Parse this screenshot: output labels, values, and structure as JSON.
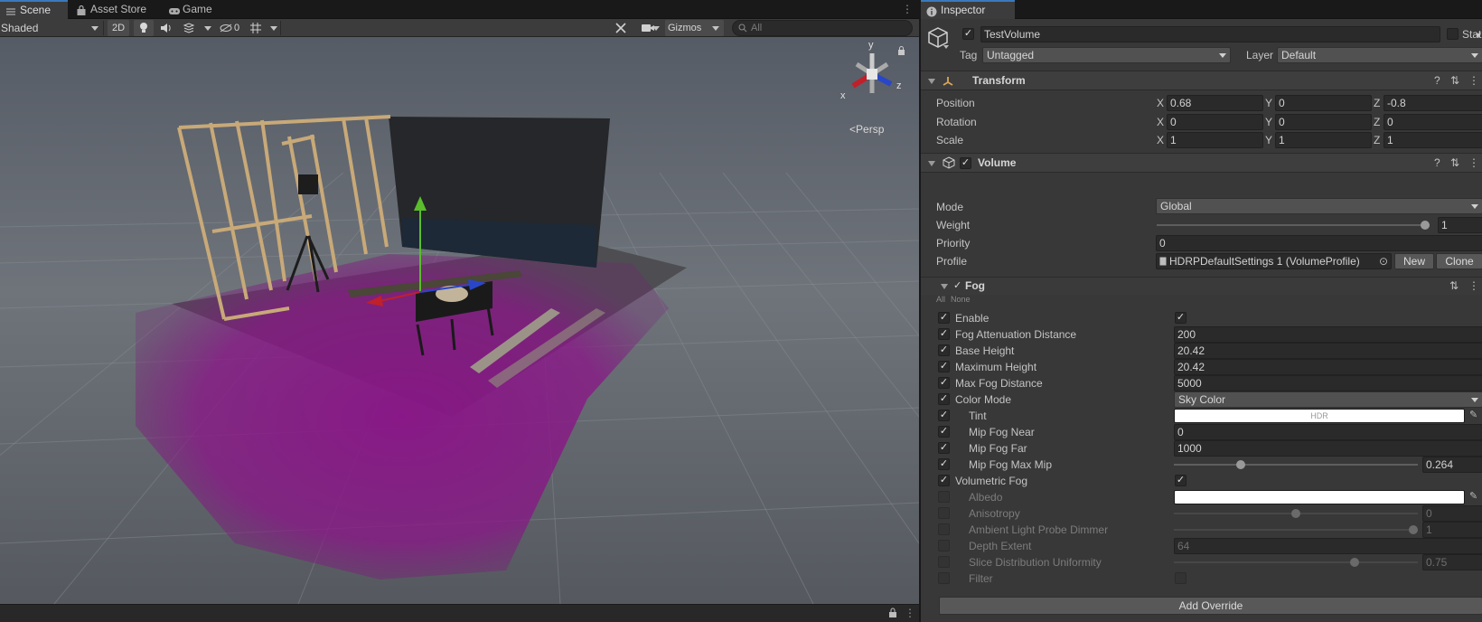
{
  "scene_tabs": [
    {
      "label": "Scene"
    },
    {
      "label": "Asset Store"
    },
    {
      "label": "Game"
    }
  ],
  "scene_toolbar": {
    "shading_mode": "Shaded",
    "mode_2d": "2D",
    "hidden_count": "0",
    "gizmos": "Gizmos",
    "search_placeholder": "All"
  },
  "orientation_gizmo": {
    "y": "y",
    "x": "x",
    "z": "z",
    "projection": "Persp"
  },
  "inspector": {
    "tab": "Inspector",
    "object_name": "TestVolume",
    "static_label": "Static",
    "tag_label": "Tag",
    "tag_value": "Untagged",
    "layer_label": "Layer",
    "layer_value": "Default",
    "transform": {
      "title": "Transform",
      "rows": [
        {
          "label": "Position",
          "x": "0.68",
          "y": "0",
          "z": "-0.8"
        },
        {
          "label": "Rotation",
          "x": "0",
          "y": "0",
          "z": "0"
        },
        {
          "label": "Scale",
          "x": "1",
          "y": "1",
          "z": "1"
        }
      ],
      "axis_x": "X",
      "axis_y": "Y",
      "axis_z": "Z"
    },
    "volume": {
      "title": "Volume",
      "mode_label": "Mode",
      "mode_value": "Global",
      "weight_label": "Weight",
      "weight_value": "1",
      "weight_fraction": 1.0,
      "priority_label": "Priority",
      "priority_value": "0",
      "profile_label": "Profile",
      "profile_value": "HDRPDefaultSettings 1 (VolumeProfile)",
      "new_label": "New",
      "clone_label": "Clone"
    },
    "fog": {
      "title": "Fog",
      "all_label": "All",
      "none_label": "None",
      "rows": [
        {
          "label": "Enable",
          "override": true,
          "type": "check",
          "value": true
        },
        {
          "label": "Fog Attenuation Distance",
          "override": true,
          "type": "text",
          "value": "200"
        },
        {
          "label": "Base Height",
          "override": true,
          "type": "text",
          "value": "20.42"
        },
        {
          "label": "Maximum Height",
          "override": true,
          "type": "text",
          "value": "20.42"
        },
        {
          "label": "Max Fog Distance",
          "override": true,
          "type": "text",
          "value": "5000"
        },
        {
          "label": "Color Mode",
          "override": true,
          "type": "dropdown",
          "value": "Sky Color"
        },
        {
          "label": "Tint",
          "override": true,
          "type": "color",
          "value": "HDR",
          "indent": true
        },
        {
          "label": "Mip Fog Near",
          "override": true,
          "type": "text",
          "value": "0",
          "indent": true
        },
        {
          "label": "Mip Fog Far",
          "override": true,
          "type": "text",
          "value": "1000",
          "indent": true
        },
        {
          "label": "Mip Fog Max Mip",
          "override": true,
          "type": "slider",
          "value": "0.264",
          "fraction": 0.264,
          "indent": true
        },
        {
          "label": "Volumetric Fog",
          "override": true,
          "type": "check",
          "value": true
        },
        {
          "label": "Albedo",
          "override": false,
          "type": "color",
          "value": "",
          "indent": true,
          "dim": true
        },
        {
          "label": "Anisotropy",
          "override": false,
          "type": "slider",
          "value": "0",
          "fraction": 0.5,
          "indent": true,
          "dim": true
        },
        {
          "label": "Ambient Light Probe Dimmer",
          "override": false,
          "type": "slider",
          "value": "1",
          "fraction": 1.0,
          "indent": true,
          "dim": true
        },
        {
          "label": "Depth Extent",
          "override": false,
          "type": "text",
          "value": "64",
          "indent": true,
          "dim": true
        },
        {
          "label": "Slice Distribution Uniformity",
          "override": false,
          "type": "slider",
          "value": "0.75",
          "fraction": 0.75,
          "indent": true,
          "dim": true
        },
        {
          "label": "Filter",
          "override": false,
          "type": "check",
          "value": false,
          "indent": true,
          "dim": true
        }
      ]
    },
    "add_override": "Add Override"
  },
  "colors": {
    "fog_purple": "#7a1a7a",
    "accent_blue": "#3a79bb",
    "axis_y_green": "#5bbd2d",
    "axis_x_red": "#c0202a",
    "axis_z_blue": "#2a46c8"
  }
}
